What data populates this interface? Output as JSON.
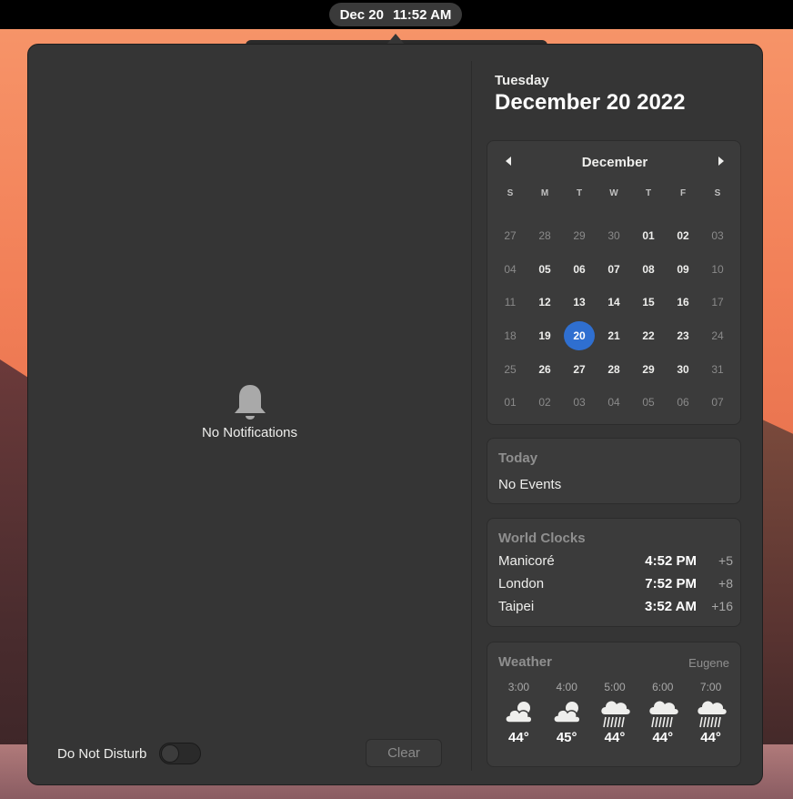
{
  "topbar": {
    "date": "Dec 20",
    "time": "11:52 AM"
  },
  "notifications": {
    "empty_label": "No Notifications",
    "dnd_label": "Do Not Disturb",
    "dnd_enabled": false,
    "clear_label": "Clear"
  },
  "date_header": {
    "weekday": "Tuesday",
    "full_date": "December 20 2022"
  },
  "calendar": {
    "month": "December",
    "weekdays": [
      "S",
      "M",
      "T",
      "W",
      "T",
      "F",
      "S"
    ],
    "today": "20",
    "weeks": [
      [
        {
          "d": "27",
          "dim": true
        },
        {
          "d": "28",
          "dim": true
        },
        {
          "d": "29",
          "dim": true
        },
        {
          "d": "30",
          "dim": true
        },
        {
          "d": "01",
          "dim": false
        },
        {
          "d": "02",
          "dim": false
        },
        {
          "d": "03",
          "dim": true
        }
      ],
      [
        {
          "d": "04",
          "dim": true
        },
        {
          "d": "05",
          "dim": false
        },
        {
          "d": "06",
          "dim": false
        },
        {
          "d": "07",
          "dim": false
        },
        {
          "d": "08",
          "dim": false
        },
        {
          "d": "09",
          "dim": false
        },
        {
          "d": "10",
          "dim": true
        }
      ],
      [
        {
          "d": "11",
          "dim": true
        },
        {
          "d": "12",
          "dim": false
        },
        {
          "d": "13",
          "dim": false
        },
        {
          "d": "14",
          "dim": false
        },
        {
          "d": "15",
          "dim": false
        },
        {
          "d": "16",
          "dim": false
        },
        {
          "d": "17",
          "dim": true
        }
      ],
      [
        {
          "d": "18",
          "dim": true
        },
        {
          "d": "19",
          "dim": false
        },
        {
          "d": "20",
          "dim": false
        },
        {
          "d": "21",
          "dim": false
        },
        {
          "d": "22",
          "dim": false
        },
        {
          "d": "23",
          "dim": false
        },
        {
          "d": "24",
          "dim": true
        }
      ],
      [
        {
          "d": "25",
          "dim": true
        },
        {
          "d": "26",
          "dim": false
        },
        {
          "d": "27",
          "dim": false
        },
        {
          "d": "28",
          "dim": false
        },
        {
          "d": "29",
          "dim": false
        },
        {
          "d": "30",
          "dim": false
        },
        {
          "d": "31",
          "dim": true
        }
      ],
      [
        {
          "d": "01",
          "dim": true
        },
        {
          "d": "02",
          "dim": true
        },
        {
          "d": "03",
          "dim": true
        },
        {
          "d": "04",
          "dim": true
        },
        {
          "d": "05",
          "dim": true
        },
        {
          "d": "06",
          "dim": true
        },
        {
          "d": "07",
          "dim": true
        }
      ]
    ]
  },
  "events": {
    "title": "Today",
    "empty_label": "No Events"
  },
  "world_clocks": {
    "title": "World Clocks",
    "items": [
      {
        "city": "Manicoré",
        "time": "4:52 PM",
        "offset": "+5"
      },
      {
        "city": "London",
        "time": "7:52 PM",
        "offset": "+8"
      },
      {
        "city": "Taipei",
        "time": "3:52 AM",
        "offset": "+16"
      }
    ]
  },
  "weather": {
    "title": "Weather",
    "location": "Eugene",
    "forecast": [
      {
        "hour": "3:00",
        "icon": "cloudy-sun-icon",
        "temp": "44°"
      },
      {
        "hour": "4:00",
        "icon": "cloudy-sun-icon",
        "temp": "45°"
      },
      {
        "hour": "5:00",
        "icon": "rain-icon",
        "temp": "44°"
      },
      {
        "hour": "6:00",
        "icon": "rain-icon",
        "temp": "44°"
      },
      {
        "hour": "7:00",
        "icon": "rain-icon",
        "temp": "44°"
      }
    ]
  },
  "colors": {
    "accent": "#2f6fd0",
    "panel_bg": "#353535",
    "card_bg": "#3b3b3b"
  }
}
